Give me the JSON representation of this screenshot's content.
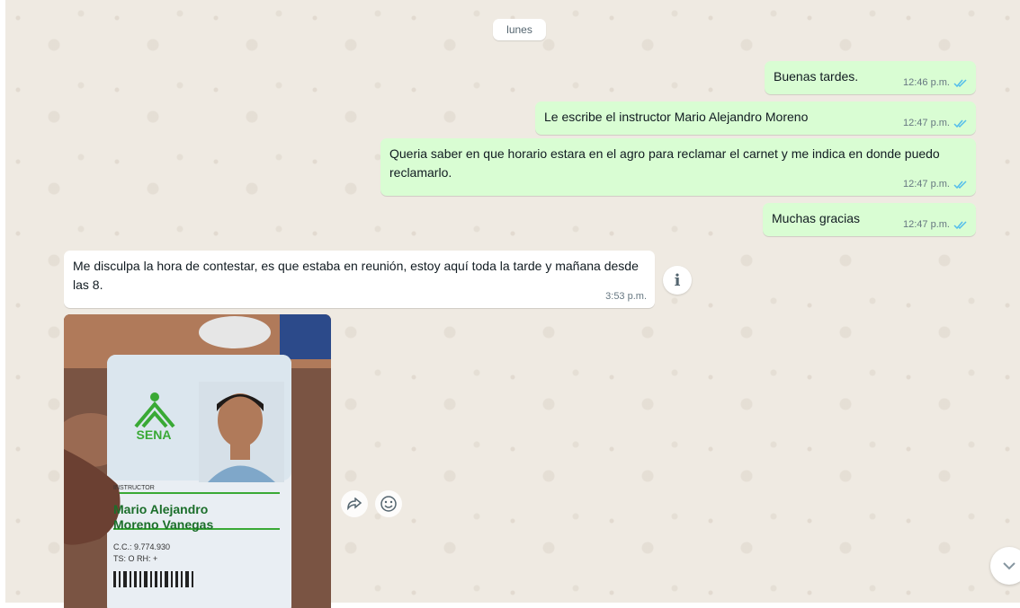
{
  "date_chip": "lunes",
  "messages": [
    {
      "text": "Buenas tardes.",
      "time": "12:46 p.m."
    },
    {
      "text": "Le escribe el instructor Mario Alejandro Moreno",
      "time": "12:47 p.m."
    },
    {
      "text": "Queria saber en que horario estara en el agro para reclamar el carnet y me indica en donde puedo reclamarlo.",
      "time": "12:47 p.m."
    },
    {
      "text": "Muchas gracias",
      "time": "12:47 p.m."
    },
    {
      "text": "Me disculpa la hora de contestar, es que estaba en reunión, estoy aquí toda la tarde y mañana desde las 8.",
      "time": "3:53 p.m."
    }
  ],
  "id_card": {
    "logo": "SENA",
    "role": "INSTRUCTOR",
    "name_line1": "Mario Alejandro",
    "name_line2": "Moreno Vanegas",
    "cc": "C.C.: 9.774.930",
    "rh": "TS: O RH: +"
  },
  "icons": {
    "info": "info-icon",
    "forward": "forward-icon",
    "emoji": "emoji-icon",
    "scroll_down": "chevron-down-icon",
    "read_receipt": "double-check-icon"
  },
  "colors": {
    "outgoing_bubble": "#d9fdd3",
    "incoming_bubble": "#ffffff",
    "read_tick": "#53bdeb",
    "chat_background": "#efeae2",
    "sena_green": "#39a935"
  }
}
